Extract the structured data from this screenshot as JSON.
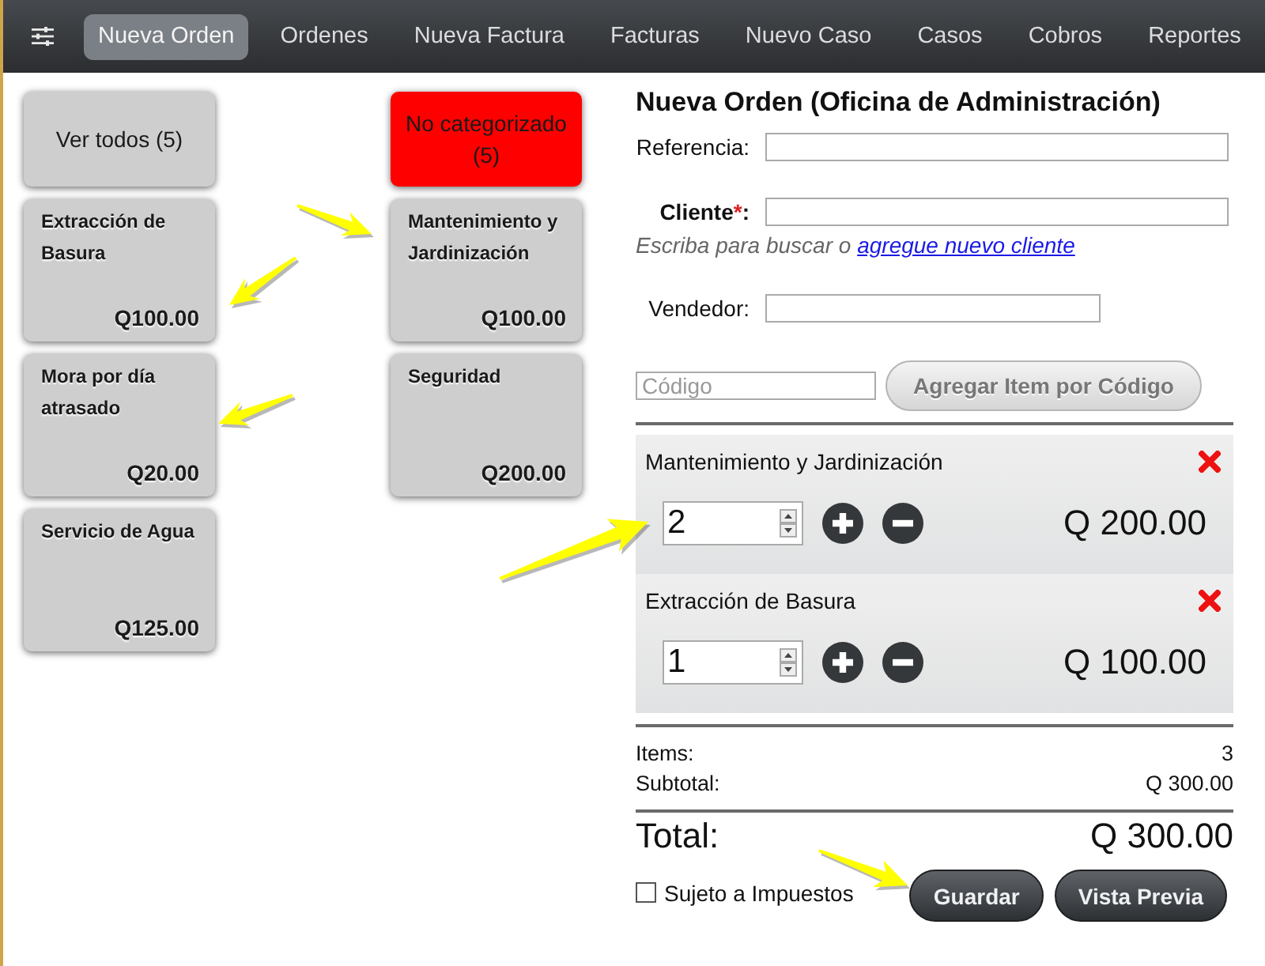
{
  "tabs": [
    {
      "label": "Nueva Orden",
      "selected": true
    },
    {
      "label": "Ordenes",
      "selected": false
    },
    {
      "label": "Nueva Factura",
      "selected": false
    },
    {
      "label": "Facturas",
      "selected": false
    },
    {
      "label": "Nuevo Caso",
      "selected": false
    },
    {
      "label": "Casos",
      "selected": false
    },
    {
      "label": "Cobros",
      "selected": false
    },
    {
      "label": "Reportes",
      "selected": false
    }
  ],
  "categories": [
    {
      "label": "Ver todos (5)",
      "selected": false
    },
    {
      "label": "No categorizado (5)",
      "selected": true
    }
  ],
  "products": [
    {
      "name": "Extracción de Basura",
      "price": "Q100.00"
    },
    {
      "name": "Mantenimiento y Jardinización",
      "price": "Q100.00"
    },
    {
      "name": "Mora por día atrasado",
      "price": "Q20.00"
    },
    {
      "name": "Seguridad",
      "price": "Q200.00"
    },
    {
      "name": "Servicio de Agua",
      "price": "Q125.00"
    }
  ],
  "order": {
    "title": "Nueva Orden (Oficina de Administración)",
    "reference": {
      "label": "Referencia:"
    },
    "client": {
      "label": "Cliente",
      "required": true,
      "mark": "*",
      "suffix": ":",
      "hint": "Escriba para buscar o ",
      "link": "agregue nuevo cliente"
    },
    "seller": {
      "label": "Vendedor:"
    },
    "code": {
      "placeholder": "Código",
      "button": "Agregar Item por Código"
    },
    "lines": [
      {
        "name": "Mantenimiento y Jardinización",
        "quantity": "2",
        "amount": "Q 200.00"
      },
      {
        "name": "Extracción de Basura",
        "quantity": "1",
        "amount": "Q 100.00"
      }
    ],
    "summary": [
      {
        "label": "Items:",
        "value": "3"
      },
      {
        "label": "Subtotal:",
        "value": "Q 300.00"
      }
    ],
    "total": {
      "label": "Total:",
      "value": "Q 300.00"
    },
    "tax": {
      "label": "Sujeto a Impuestos",
      "checked": false
    },
    "buttons": [
      "Guardar",
      "Vista Previa"
    ]
  }
}
